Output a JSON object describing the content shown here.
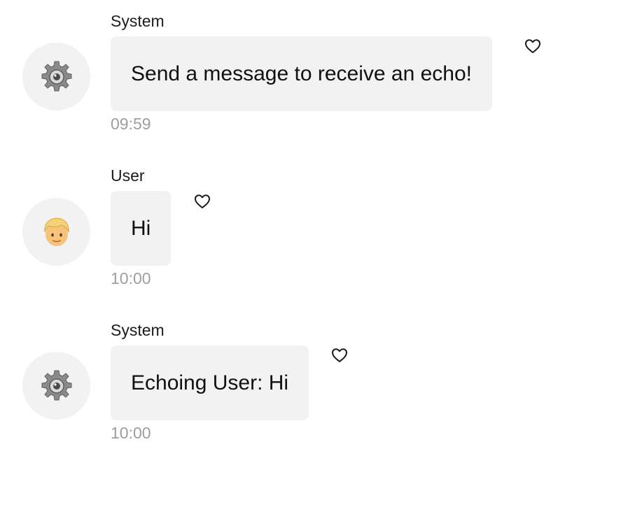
{
  "messages": [
    {
      "sender": "System",
      "avatar_icon": "gear-icon",
      "text": "Send a message to receive an echo!",
      "time": "09:59"
    },
    {
      "sender": "User",
      "avatar_icon": "person-face-icon",
      "text": "Hi",
      "time": "10:00"
    },
    {
      "sender": "System",
      "avatar_icon": "gear-icon",
      "text": "Echoing User: Hi",
      "time": "10:00"
    }
  ],
  "icons": {
    "like": "heart-outline-icon"
  },
  "colors": {
    "bubble": "#f2f2f2",
    "avatar_bg": "#f2f2f2",
    "timestamp": "#9e9e9e",
    "text": "#111111"
  }
}
